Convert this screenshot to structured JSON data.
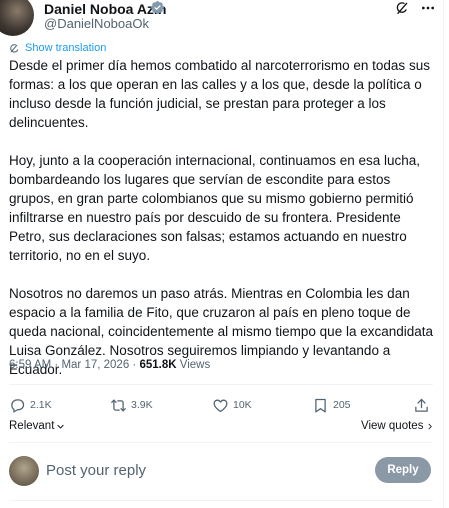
{
  "author": {
    "name": "Daniel Noboa Azin",
    "handle": "@DanielNoboaOk"
  },
  "translation": {
    "label": "Show translation"
  },
  "tweet": {
    "paragraphs": [
      "Desde el primer día hemos combatido al narcoterrorismo en todas sus formas: a los que operan en las calles y a los que, desde la política o incluso desde la función judicial, se prestan para proteger a los delincuentes.",
      "Hoy, junto a la cooperación internacional, continuamos en esa lucha, bombardeando los lugares que servían de escondite para estos grupos, en gran parte colombianos que su mismo gobierno permitió infiltrarse en nuestro país por descuido de su frontera. Presidente Petro, sus declaraciones son falsas; estamos actuando en nuestro territorio, no en el suyo.",
      "Nosotros no daremos un paso atrás. Mientras en Colombia les dan espacio a la familia de Fito, que cruzaron al país en pleno toque de queda nacional, coincidentemente al mismo tiempo que la excandidata Luisa González. Nosotros seguiremos limpiando y levantando a Ecuador."
    ],
    "time": "6:59 AM",
    "date": "Mar 17, 2026",
    "separator": "·",
    "views_count": "651.8K",
    "views_label": "Views"
  },
  "actions": {
    "replies": "2.1K",
    "reposts": "3.9K",
    "likes": "10K",
    "bookmarks": "205"
  },
  "sort": {
    "label": "Relevant"
  },
  "view_quotes": {
    "label": "View quotes"
  },
  "reply_box": {
    "placeholder": "Post your reply",
    "button_label": "Reply"
  },
  "colors": {
    "accent": "#1d9bf0",
    "text": "#0f1419",
    "muted": "#536471",
    "reply_button_disabled": "#8b98a5"
  },
  "icons": [
    "verified-badge-icon",
    "grok-icon",
    "more-icon",
    "translate-icon",
    "reply-icon",
    "repost-icon",
    "like-icon",
    "bookmark-icon",
    "share-icon",
    "chevron-down-icon",
    "chevron-right-icon"
  ]
}
